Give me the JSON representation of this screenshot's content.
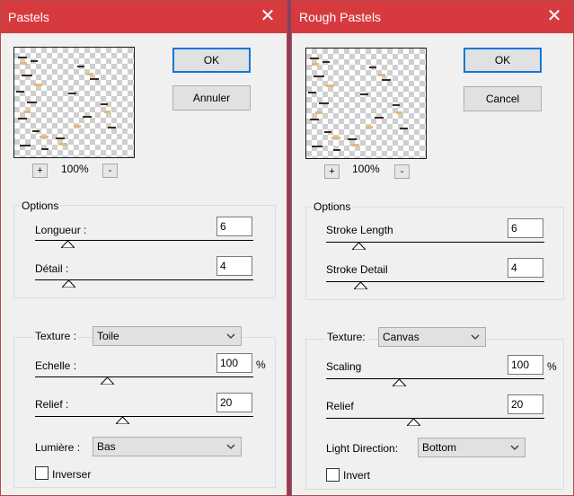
{
  "colors": {
    "titlebar": "#d63a3f",
    "dialog_bg": "#f0f0f0",
    "default_button_border": "#0a78d7"
  },
  "left_dialog": {
    "title": "Pastels",
    "close_icon": "close-icon",
    "zoom": "100%",
    "zoom_in": "+",
    "zoom_out": "-",
    "ok_label": "OK",
    "cancel_label": "Annuler",
    "options": {
      "legend": "Options",
      "stroke_length_label": "Longueur :",
      "stroke_length_value": "6",
      "stroke_detail_label": "Détail :",
      "stroke_detail_value": "4"
    },
    "texture": {
      "label": "Texture :",
      "selected": "Toile",
      "scaling_label": "Echelle :",
      "scaling_value": "100",
      "percent": "%",
      "relief_label": "Relief :",
      "relief_value": "20",
      "light_label": "Lumière :",
      "light_selected": "Bas",
      "invert_label": "Inverser",
      "invert_checked": false
    }
  },
  "right_dialog": {
    "title": "Rough Pastels",
    "close_icon": "close-icon",
    "zoom": "100%",
    "zoom_in": "+",
    "zoom_out": "-",
    "ok_label": "OK",
    "cancel_label": "Cancel",
    "options": {
      "legend": "Options",
      "stroke_length_label": "Stroke Length",
      "stroke_length_value": "6",
      "stroke_detail_label": "Stroke Detail",
      "stroke_detail_value": "4"
    },
    "texture": {
      "label": "Texture:",
      "selected": "Canvas",
      "scaling_label": "Scaling",
      "scaling_value": "100",
      "percent": "%",
      "relief_label": "Relief",
      "relief_value": "20",
      "light_label": "Light Direction:",
      "light_selected": "Bottom",
      "invert_label": "Invert",
      "invert_checked": false
    }
  }
}
